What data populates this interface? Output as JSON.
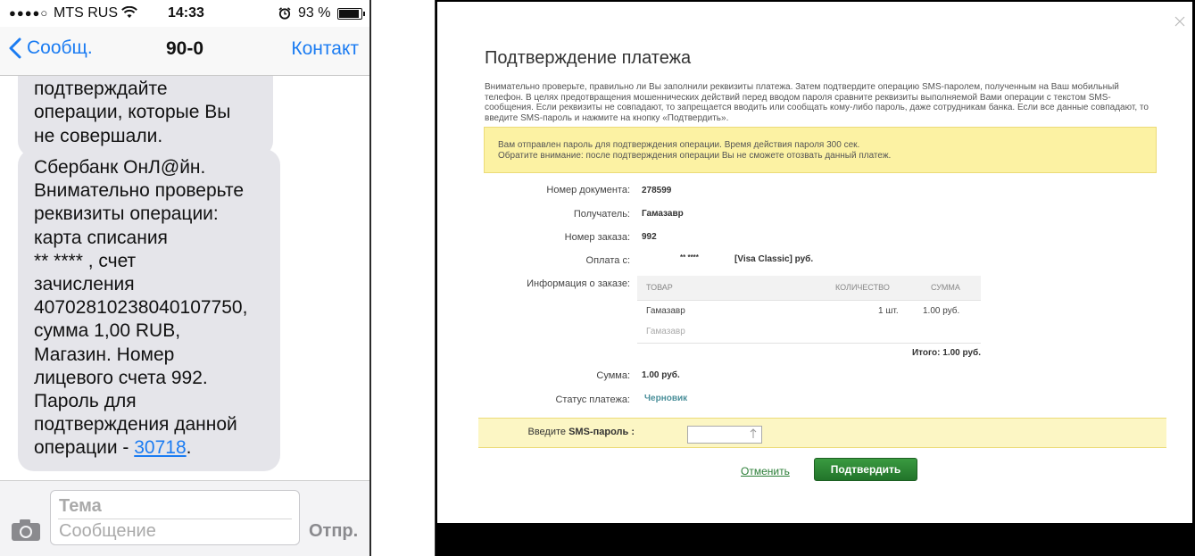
{
  "phone": {
    "status": {
      "signal": "●●●●○",
      "carrier": "MTS RUS",
      "time": "14:33",
      "battery": "93 %",
      "battery_level": 0.93
    },
    "nav": {
      "back_label": "Сообщ.",
      "title": "90-0",
      "contact_label": "Контакт"
    },
    "messages": [
      {
        "text": "подтверждайте\nоперации, которые Вы\nне совершали."
      },
      {
        "text": "Сбербанк ОнЛ@йн.\nВнимательно проверьте\nреквизиты операции:\nкарта списания\n      ** ****           , счет\nзачисления\n40702810238040107750,\nсумма 1,00 RUB,\nМагазин.  Номер\nлицевого счета 992.\nПароль для\nподтверждения данной\nоперации - ",
        "code": "30718",
        "end": "."
      }
    ],
    "compose": {
      "subject_placeholder": "Тема",
      "message_placeholder": "Сообщение",
      "send_label": "Отпр."
    }
  },
  "modal": {
    "title": "Подтверждение платежа",
    "intro": "Внимательно проверьте, правильно ли Вы заполнили реквизиты платежа. Затем подтвердите операцию SMS-паролем, полученным на Ваш мобильный телефон. В целях предотвращения мошеннических действий перед вводом пароля сравните реквизиты выполняемой Вами операции с текстом SMS-сообщения. Если реквизиты не совпадают, то запрещается вводить или сообщать кому-либо пароль, даже сотрудникам банка. Если все данные совпадают, то введите SMS-пароль и нажмите на кнопку «Подтвердить».",
    "notice_line1": "Вам отправлен пароль для подтверждения операции. Время действия пароля 300 сек.",
    "notice_line2": "Обратите внимание: после подтверждения операции Вы не сможете отозвать данный платеж.",
    "fields": {
      "doc_number_label": "Номер документа:",
      "doc_number": "278599",
      "recipient_label": "Получатель:",
      "recipient": "Гамазавр",
      "order_number_label": "Номер заказа:",
      "order_number": "992",
      "paid_from_label": "Оплата с:",
      "paid_from_card": "** ****",
      "paid_from_type": "[Visa Classic]  руб.",
      "order_info_label": "Информация о заказе:",
      "amount_label": "Сумма:",
      "amount": "1.00  руб.",
      "status_label": "Статус платежа:",
      "status": "Черновик"
    },
    "order_table": {
      "col_item": "ТОВАР",
      "col_qty": "КОЛИЧЕСТВО",
      "col_sum": "СУММА",
      "row_item": "Гамазавр",
      "row_qty": "1 шт.",
      "row_sum": "1.00  руб.",
      "row_sub": "Гамазавр",
      "total": "Итого: 1.00 руб."
    },
    "sms": {
      "label_prefix": "Введите ",
      "label_bold": "SMS-пароль :",
      "value": ""
    },
    "cancel_label": "Отменить",
    "confirm_label": "Подтвердить"
  }
}
